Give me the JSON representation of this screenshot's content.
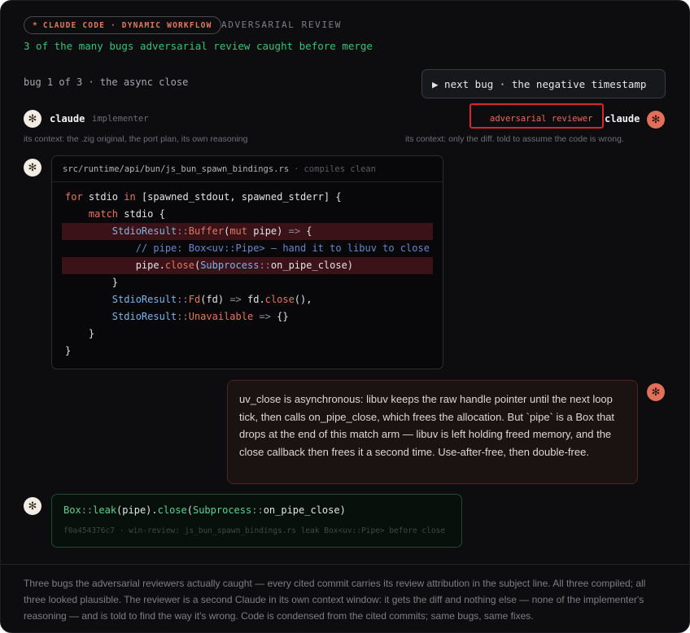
{
  "header": {
    "pill_icon": "*",
    "pill_text": "CLAUDE CODE · DYNAMIC WORKFLOW",
    "title": "ADVERSARIAL REVIEW",
    "subtitle": "3 of the many bugs adversarial review caught before merge"
  },
  "nav": {
    "bug_label": "bug 1 of 3 · the async close",
    "next_button": "▶ next bug · the negative timestamp"
  },
  "implementer": {
    "name": "claude",
    "role": "implementer",
    "context": "its context: the .zig original, the port plan, its own reasoning"
  },
  "reviewer": {
    "name": "claude",
    "role": "adversarial reviewer",
    "context": "its context: only the diff. told to assume the code is wrong."
  },
  "code_card": {
    "path": "src/runtime/api/bun/js_bun_spawn_bindings.rs",
    "separator": "·",
    "status": "compiles clean"
  },
  "review_message": "uv_close is asynchronous: libuv keeps the raw handle pointer until the next loop tick, then calls on_pipe_close, which frees the allocation. But `pipe` is a Box that drops at the end of this match arm — libuv is left holding freed memory, and the close callback then frees it a second time. Use-after-free, then double-free.",
  "fix": {
    "meta": "f0a454376c7 · win-review: js_bun_spawn_bindings.rs leak Box<uv::Pipe> before close"
  },
  "footer": "Three bugs the adversarial reviewers actually caught — every cited commit carries its review attribution in the subject line. All three compiled; all three looked plausible. The reviewer is a second Claude in its own context window: it gets the diff and nothing else — none of the implementer's reasoning — and is told to find the way it's wrong. Code is condensed from the cited commits; same bugs, same fixes.",
  "colors": {
    "accent": "#e2785e",
    "green": "#3fbf7a",
    "highlight_box": "#d6282a"
  },
  "icons": {
    "avatar": "asterisk-icon"
  }
}
